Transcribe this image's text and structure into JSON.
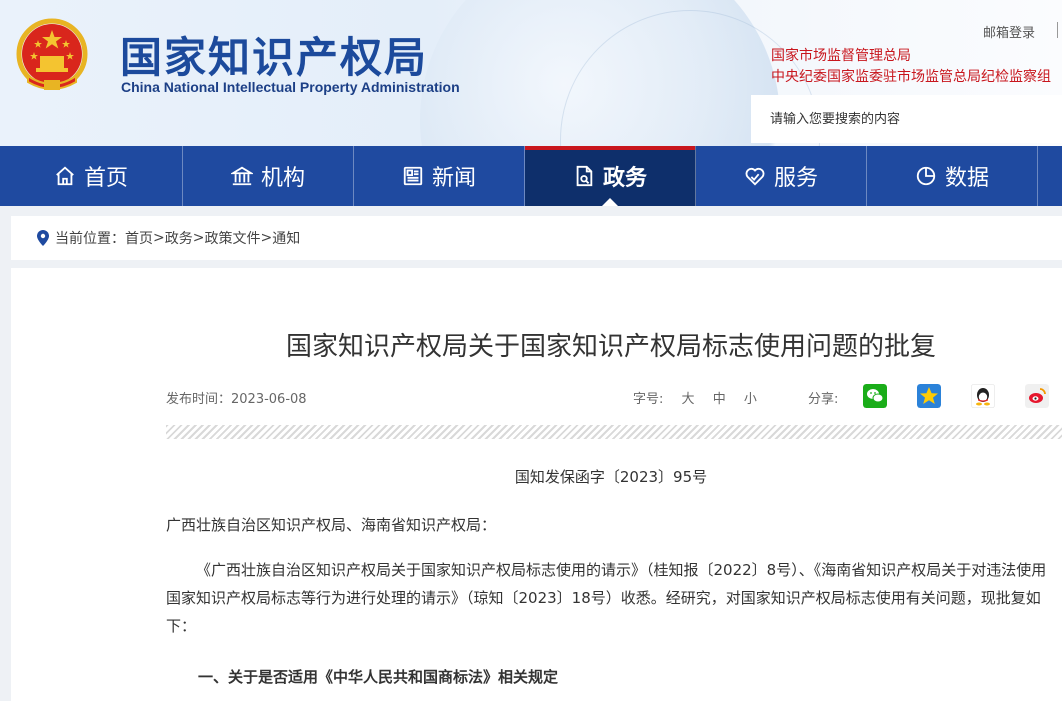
{
  "header": {
    "cn_title": "国家知识产权局",
    "en_title": "China National Intellectual Property Administration",
    "mail_link": "邮箱登录",
    "red_links": [
      "国家市场监督管理总局",
      "中央纪委国家监委驻市场监管总局纪检监察组"
    ],
    "search_placeholder": "请输入您要搜索的内容"
  },
  "nav": {
    "items": [
      {
        "label": "首页",
        "icon": "home-icon"
      },
      {
        "label": "机构",
        "icon": "institution-icon"
      },
      {
        "label": "新闻",
        "icon": "news-icon"
      },
      {
        "label": "政务",
        "icon": "government-affairs-icon",
        "active": true
      },
      {
        "label": "服务",
        "icon": "service-icon"
      },
      {
        "label": "数据",
        "icon": "data-pie-icon"
      }
    ]
  },
  "breadcrumb": {
    "prefix": "当前位置：",
    "items": [
      "首页",
      "政务",
      "政策文件",
      "通知"
    ],
    "separator": ">"
  },
  "article": {
    "title": "国家知识产权局关于国家知识产权局标志使用问题的批复",
    "publish_date": "发布时间：2023-06-08",
    "font_size_label": "字号:",
    "font_sizes": [
      "大",
      "中",
      "小"
    ],
    "share_label": "分享:",
    "share_icons": [
      "wechat-icon",
      "qzone-icon",
      "qq-icon",
      "weibo-icon"
    ],
    "doc_number": "国知发保函字〔2023〕95号",
    "addressee": "广西壮族自治区知识产权局、海南省知识产权局：",
    "paragraph1": "《广西壮族自治区知识产权局关于国家知识产权局标志使用的请示》（桂知报〔2022〕8号）、《海南省知识产权局关于对违法使用国家知识产权局标志等行为进行处理的请示》（琼知〔2023〕18号）收悉。经研究，对国家知识产权局标志使用有关问题，现批复如下：",
    "heading1": "一、关于是否适用《中华人民共和国商标法》相关规定"
  },
  "colors": {
    "nav_bg": "#1f4aa0",
    "nav_active_bg": "#0e2f6b",
    "accent_red": "#c8161d",
    "title_blue": "#1c4a9c"
  }
}
